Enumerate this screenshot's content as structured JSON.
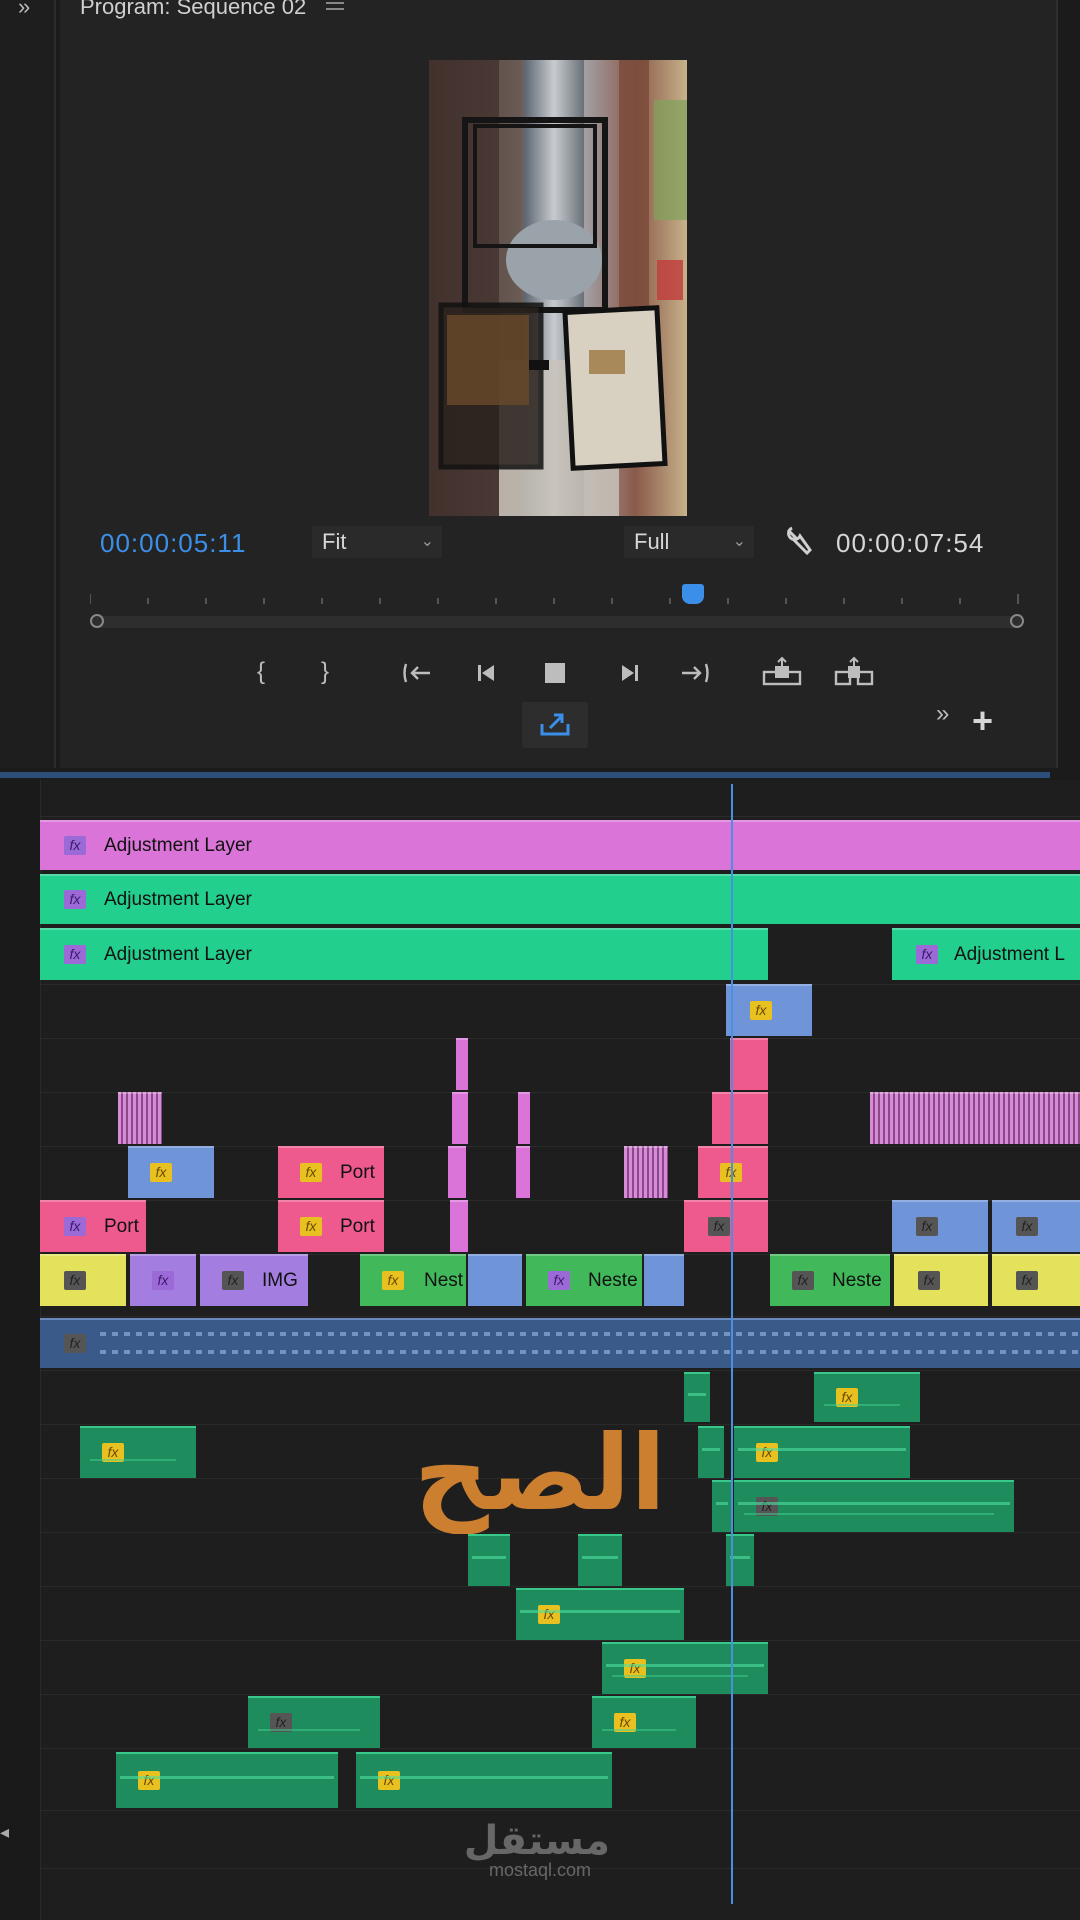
{
  "program_monitor": {
    "title": "Program: Sequence 02",
    "menu_icon": "menu-icon",
    "current_timecode": "00:00:05:11",
    "zoom_select": "Fit",
    "resolution_select": "Full",
    "duration_timecode": "00:00:07:54",
    "playhead_position": 0.65,
    "colors": {
      "timecode": "#3c8fe8",
      "panel": "#232323"
    }
  },
  "transport": {
    "mark_in": "{",
    "mark_out": "}",
    "go_to_in": "{←",
    "step_back": "◀|",
    "stop": "■",
    "step_forward": "|▶",
    "go_to_out": "→}",
    "lift": "lift-icon",
    "extract": "extract-icon",
    "export_frame": "export-frame-icon",
    "more": "»",
    "add": "+"
  },
  "timeline": {
    "adjustment_layers": [
      {
        "label": "Adjustment Layer",
        "color": "#db74d8"
      },
      {
        "label": "Adjustment Layer",
        "color": "#22cf8c"
      },
      {
        "label": "Adjustment Layer",
        "color": "#22cf8c"
      },
      {
        "label": "Adjustment L",
        "color": "#22cf8c"
      }
    ],
    "clip_labels": {
      "port1": "Port",
      "port2": "Port",
      "port3": "Port",
      "img": "IMG",
      "nest1": "Nest",
      "nest2": "Neste",
      "nest3": "Neste"
    },
    "fx_badge": "fx",
    "colors": {
      "pink": "#ee5a8d",
      "blue": "#6f95d8",
      "yellow": "#e4e25a",
      "lavender": "#a37ee0",
      "green": "#41b95b",
      "audio": "#1e8c5c",
      "playhead": "#4a90e2"
    }
  },
  "watermark": {
    "arabic": "الصح",
    "logo_text": "مستقل",
    "domain": "mostaql.com"
  }
}
